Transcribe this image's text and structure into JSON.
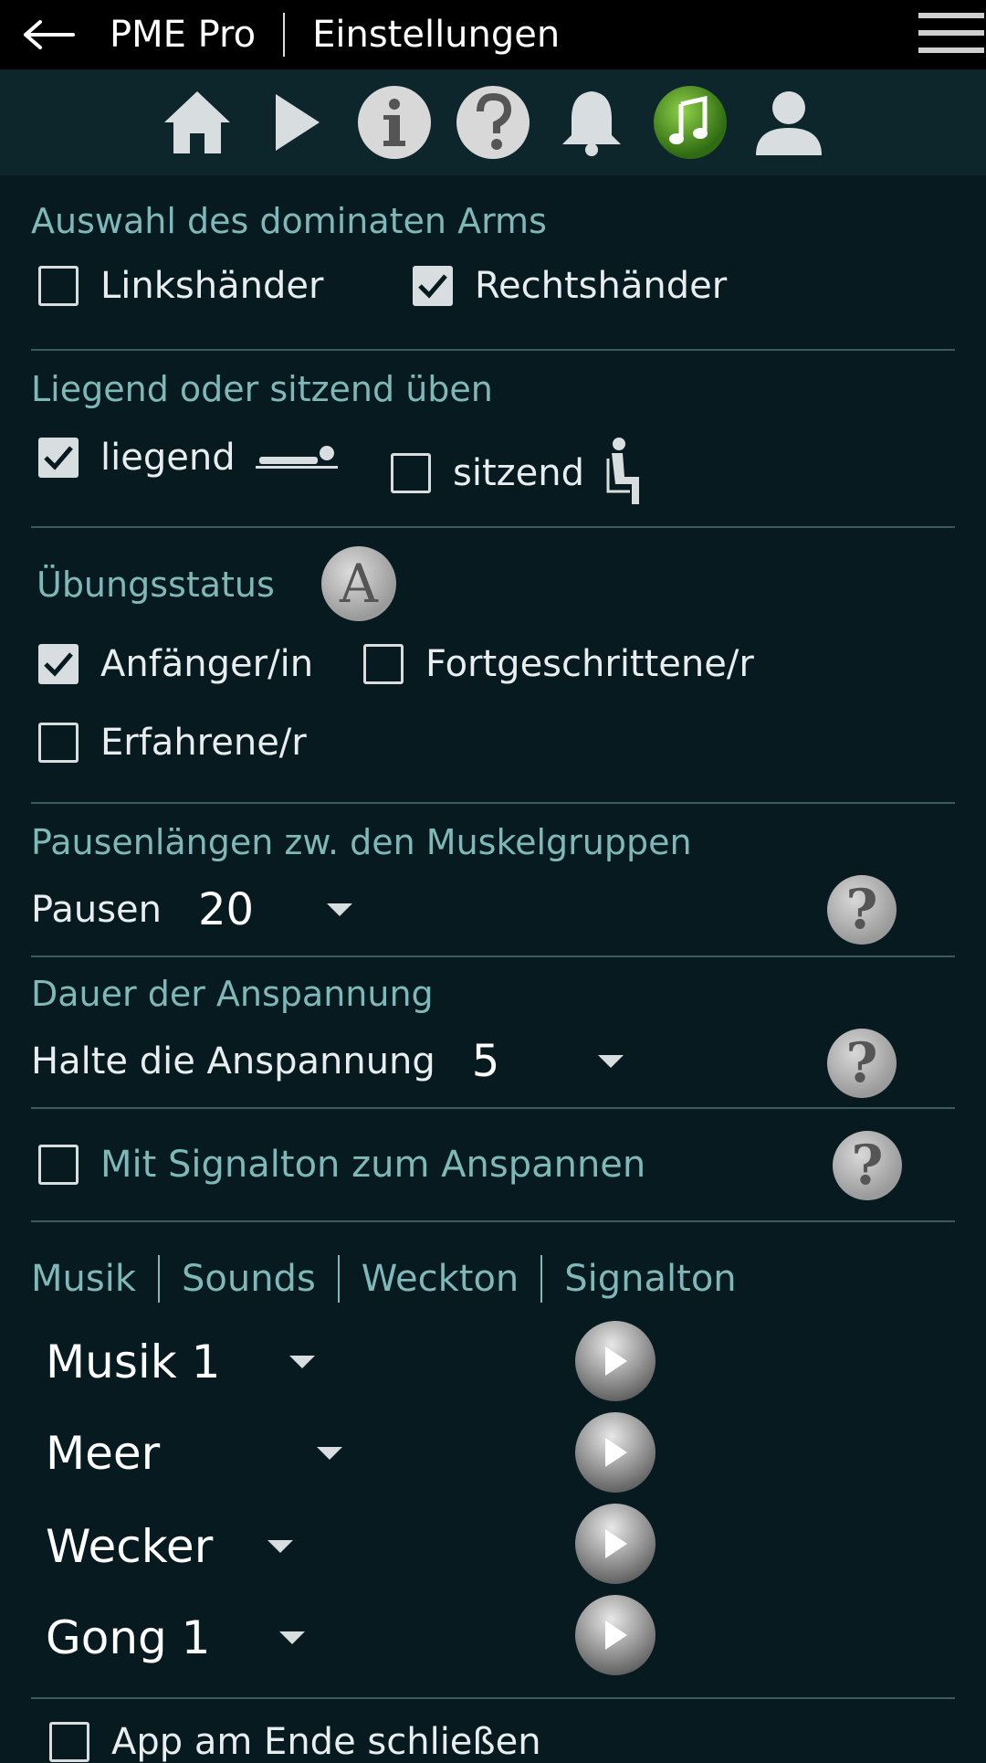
{
  "header": {
    "app_name": "PME Pro",
    "page_title": "Einstellungen"
  },
  "icons": [
    "home-icon",
    "play-icon",
    "info-icon",
    "help-icon",
    "bell-icon",
    "music-icon",
    "user-icon"
  ],
  "dominant_arm": {
    "title": "Auswahl des dominaten Arms",
    "left": {
      "label": "Linkshänder",
      "checked": false
    },
    "right": {
      "label": "Rechtshänder",
      "checked": true
    }
  },
  "posture": {
    "title": "Liegend oder sitzend üben",
    "lying": {
      "label": "liegend",
      "checked": true
    },
    "sitting": {
      "label": "sitzend",
      "checked": false
    }
  },
  "status": {
    "title": "Übungsstatus",
    "badge": "A",
    "beginner": {
      "label": "Anfänger/in",
      "checked": true
    },
    "advanced": {
      "label": "Fortgeschrittene/r",
      "checked": false
    },
    "experienced": {
      "label": "Erfahrene/r",
      "checked": false
    }
  },
  "pause": {
    "title": "Pausenlängen zw. den Muskelgruppen",
    "label": "Pausen",
    "value": "20"
  },
  "tension": {
    "title": "Dauer der Anspannung",
    "label": "Halte die Anspannung",
    "value": "5"
  },
  "signal_tension": {
    "label": "Mit Signalton zum Anspannen",
    "checked": false
  },
  "sound_tabs": [
    "Musik",
    "Sounds",
    "Weckton",
    "Signalton"
  ],
  "sound_selects": [
    {
      "value": "Musik 1"
    },
    {
      "value": "Meer"
    },
    {
      "value": "Wecker"
    },
    {
      "value": "Gong 1"
    }
  ],
  "close_app": {
    "label": "App am Ende schließen",
    "checked": false
  },
  "help_symbol": "?",
  "colors": {
    "background": "#061a20",
    "accent_text": "#7fb8b8",
    "topbar": "#000000",
    "iconbar": "#0c262c"
  }
}
